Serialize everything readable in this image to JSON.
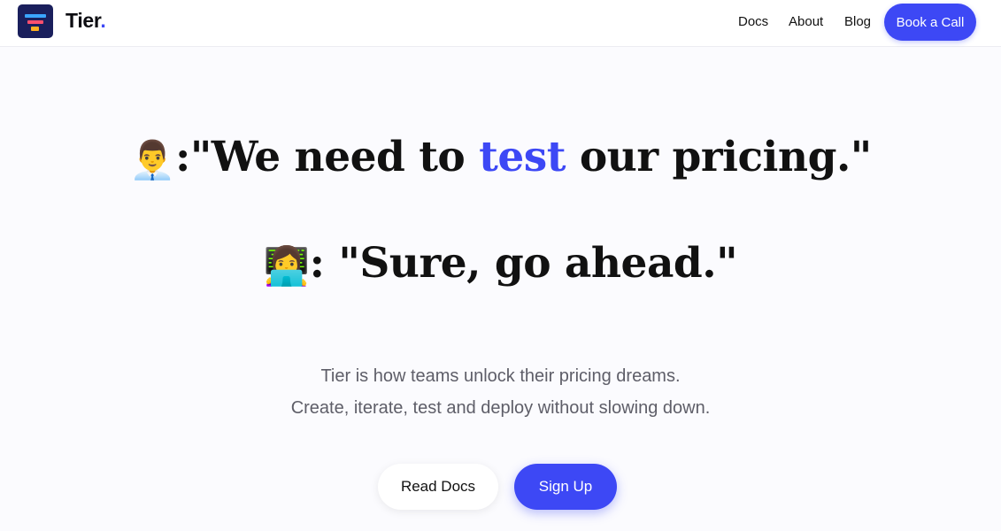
{
  "header": {
    "brand": "Tier",
    "brand_dot": ".",
    "nav": [
      "Docs",
      "About",
      "Blog"
    ],
    "cta": "Book a Call"
  },
  "hero": {
    "line1": {
      "emoji": "👨‍💼",
      "before": ":\"We need to ",
      "highlight": "test",
      "after": " our pricing.\""
    },
    "line2": {
      "emoji": "👩‍💻",
      "text": ": \"Sure, go ahead.\""
    },
    "subtitle": [
      "Tier is how teams unlock their pricing dreams.",
      "Create, iterate, test and deploy without slowing down."
    ],
    "buttons": {
      "docs": "Read Docs",
      "signup": "Sign Up"
    }
  },
  "colors": {
    "accent": "#3d48f5",
    "logo_bg": "#1a1f5c",
    "background": "#fbfbfe"
  }
}
